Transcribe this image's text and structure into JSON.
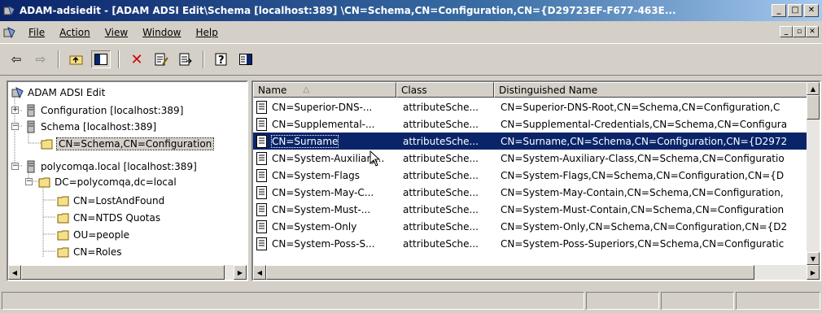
{
  "window": {
    "title": "ADAM-adsiedit - [ADAM ADSI Edit\\Schema [localhost:389] \\CN=Schema,CN=Configuration,CN={D29723EF-F677-463E...",
    "minimize": "_",
    "maximize": "□",
    "close": "✕"
  },
  "menu": {
    "items": [
      {
        "label": "File"
      },
      {
        "label": "Action"
      },
      {
        "label": "View"
      },
      {
        "label": "Window"
      },
      {
        "label": "Help"
      }
    ],
    "mdi_minimize": "_",
    "mdi_restore": "▫",
    "mdi_close": "✕"
  },
  "toolbar": {
    "back": "⇦",
    "forward": "⇨",
    "up": "⮤",
    "show_hide": "▥",
    "delete": "✕",
    "properties": "🗒",
    "export": "▤",
    "help": "❔",
    "action_pane": "▦"
  },
  "tree": {
    "root": "ADAM ADSI Edit",
    "nodes": [
      {
        "label": "Configuration [localhost:389]",
        "expander": "+"
      },
      {
        "label": "Schema [localhost:389]",
        "expander": "−"
      },
      {
        "label": "CN=Schema,CN=Configuration"
      },
      {
        "label": "polycomqa.local [localhost:389]",
        "expander": "−"
      },
      {
        "label": "DC=polycomqa,dc=local",
        "expander": "−"
      },
      {
        "label": "CN=LostAndFound"
      },
      {
        "label": "CN=NTDS Quotas"
      },
      {
        "label": "OU=people"
      },
      {
        "label": "CN=Roles"
      }
    ]
  },
  "list": {
    "columns": [
      {
        "label": "Name",
        "sort": "△"
      },
      {
        "label": "Class"
      },
      {
        "label": "Distinguished Name"
      }
    ],
    "rows": [
      {
        "name": "CN=Superior-DNS-...",
        "class": "attributeSche...",
        "dn": "CN=Superior-DNS-Root,CN=Schema,CN=Configuration,C"
      },
      {
        "name": "CN=Supplemental-...",
        "class": "attributeSche...",
        "dn": "CN=Supplemental-Credentials,CN=Schema,CN=Configura"
      },
      {
        "name": "CN=Surname",
        "class": "attributeSche...",
        "dn": "CN=Surname,CN=Schema,CN=Configuration,CN={D2972"
      },
      {
        "name": "CN=System-Auxiliary...",
        "class": "attributeSche...",
        "dn": "CN=System-Auxiliary-Class,CN=Schema,CN=Configuratio"
      },
      {
        "name": "CN=System-Flags",
        "class": "attributeSche...",
        "dn": "CN=System-Flags,CN=Schema,CN=Configuration,CN={D"
      },
      {
        "name": "CN=System-May-C...",
        "class": "attributeSche...",
        "dn": "CN=System-May-Contain,CN=Schema,CN=Configuration,"
      },
      {
        "name": "CN=System-Must-...",
        "class": "attributeSche...",
        "dn": "CN=System-Must-Contain,CN=Schema,CN=Configuration"
      },
      {
        "name": "CN=System-Only",
        "class": "attributeSche...",
        "dn": "CN=System-Only,CN=Schema,CN=Configuration,CN={D2"
      },
      {
        "name": "CN=System-Poss-S...",
        "class": "attributeSche...",
        "dn": "CN=System-Poss-Superiors,CN=Schema,CN=Configuratic"
      }
    ]
  },
  "scroll": {
    "left": "◀",
    "right": "▶",
    "up": "▲",
    "down": "▼"
  },
  "colors": {
    "selection": "#0a246a",
    "titlebar_start": "#0a246a",
    "titlebar_end": "#a6caf0",
    "face": "#d4d0c8"
  }
}
